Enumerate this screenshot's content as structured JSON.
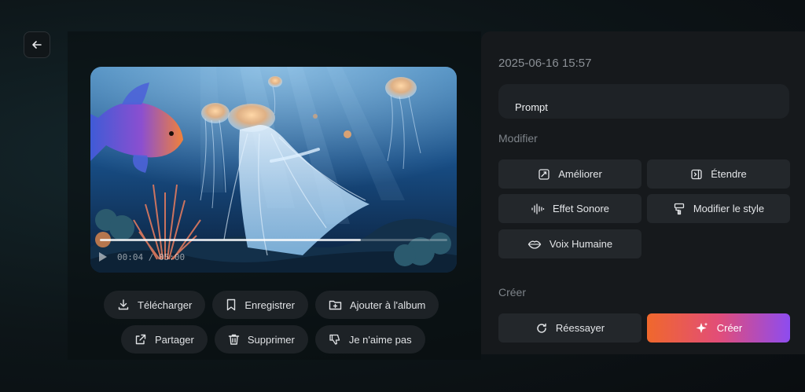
{
  "video": {
    "current_time": "00:04",
    "duration": "05:00",
    "progress": 0.75
  },
  "actions": {
    "download": "Télécharger",
    "save": "Enregistrer",
    "add_to_album": "Ajouter à l'album",
    "share": "Partager",
    "delete": "Supprimer",
    "dislike": "Je n'aime pas"
  },
  "details": {
    "timestamp": "2025-06-16 15:57",
    "prompt_label": "Prompt"
  },
  "modify": {
    "title": "Modifier",
    "improve": "Améliorer",
    "extend": "Étendre",
    "sound_effect": "Effet Sonore",
    "modify_style": "Modifier le style",
    "human_voice": "Voix Humaine"
  },
  "create": {
    "title": "Créer",
    "retry": "Réessayer",
    "create": "Créer"
  },
  "colors": {
    "create_gradient_start": "#f0682c",
    "create_gradient_mid": "#e24d78",
    "create_gradient_end": "#8d4cf0"
  }
}
